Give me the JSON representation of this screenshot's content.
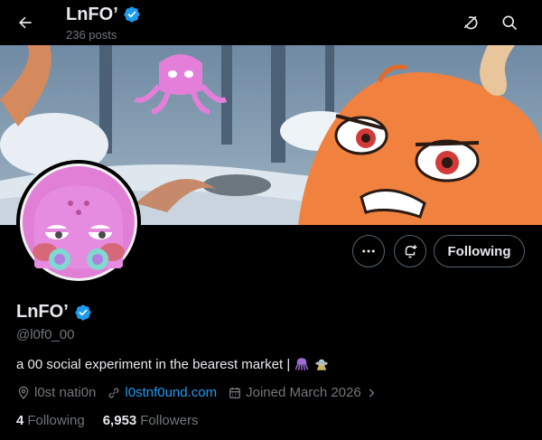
{
  "header": {
    "title": "LnFO’",
    "posts_count": "236 posts"
  },
  "profile": {
    "name": "LnFO’",
    "handle": "@l0f0_00",
    "bio": "a 00 social experiment in the bearest market |",
    "location": "l0st nati0n",
    "website": "l0stnf0und.com",
    "joined": "Joined March 2026",
    "following_count": "4",
    "following_label": "Following",
    "followers_count": "6,953",
    "followers_label": "Followers"
  },
  "actions": {
    "following_button": "Following"
  },
  "icons": {
    "back": "arrow-left-icon",
    "grok": "grok-icon",
    "search": "search-icon",
    "more": "more-icon",
    "notify": "bell-plus-icon",
    "verified": "verified-badge-icon",
    "location": "location-pin-icon",
    "link": "link-icon",
    "calendar": "calendar-icon"
  },
  "colors": {
    "accent": "#1d9bf0",
    "background": "#000000",
    "muted": "#71767b",
    "verified": "#1d9bf0",
    "octopus_pink": "#e37fd9",
    "octopus_orange": "#f0813e"
  }
}
